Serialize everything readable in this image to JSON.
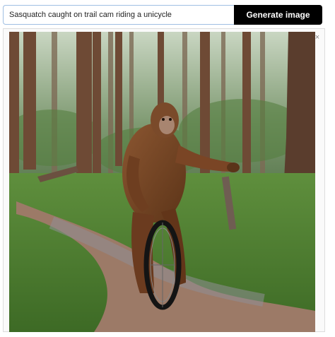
{
  "prompt": {
    "value": "Sasquatch caught on trail cam riding a unicycle",
    "placeholder": ""
  },
  "generate_button": {
    "label": "Generate image"
  },
  "result": {
    "close_icon": "close-icon",
    "close_glyph": "×"
  },
  "colors": {
    "button_bg": "#000000",
    "button_text": "#ffffff",
    "input_border": "#9fbfe3"
  }
}
